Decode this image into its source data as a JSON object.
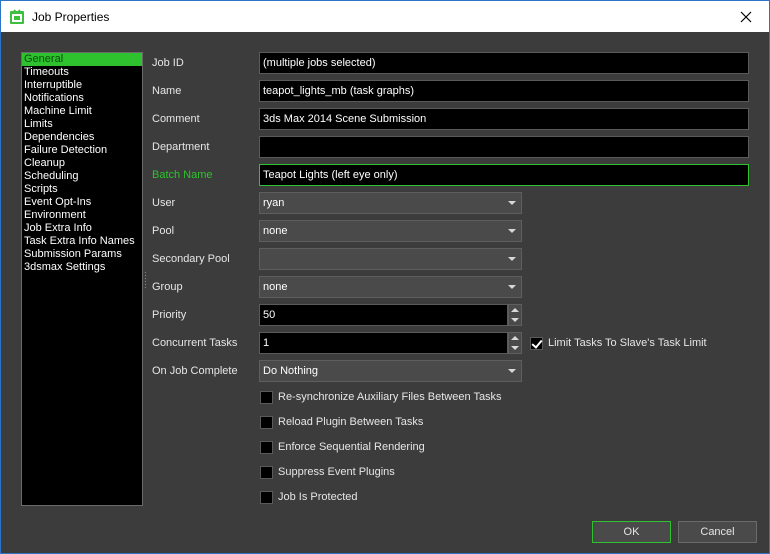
{
  "window": {
    "title": "Job Properties"
  },
  "nav": {
    "items": [
      {
        "label": "General",
        "selected": true
      },
      {
        "label": "Timeouts",
        "selected": false
      },
      {
        "label": "Interruptible",
        "selected": false
      },
      {
        "label": "Notifications",
        "selected": false
      },
      {
        "label": "Machine Limit",
        "selected": false
      },
      {
        "label": "Limits",
        "selected": false
      },
      {
        "label": "Dependencies",
        "selected": false
      },
      {
        "label": "Failure Detection",
        "selected": false
      },
      {
        "label": "Cleanup",
        "selected": false
      },
      {
        "label": "Scheduling",
        "selected": false
      },
      {
        "label": "Scripts",
        "selected": false
      },
      {
        "label": "Event Opt-Ins",
        "selected": false
      },
      {
        "label": "Environment",
        "selected": false
      },
      {
        "label": "Job Extra Info",
        "selected": false
      },
      {
        "label": "Task Extra Info Names",
        "selected": false
      },
      {
        "label": "Submission Params",
        "selected": false
      },
      {
        "label": "3dsmax Settings",
        "selected": false
      }
    ]
  },
  "form": {
    "job_id": {
      "label": "Job ID",
      "value": "(multiple jobs selected)"
    },
    "name": {
      "label": "Name",
      "value": "teapot_lights_mb   (task graphs)"
    },
    "comment": {
      "label": "Comment",
      "value": "3ds Max 2014 Scene Submission"
    },
    "department": {
      "label": "Department",
      "value": ""
    },
    "batch_name": {
      "label": "Batch Name",
      "value": "Teapot Lights (left eye only)"
    },
    "user": {
      "label": "User",
      "value": "ryan"
    },
    "pool": {
      "label": "Pool",
      "value": "none"
    },
    "secondary_pool": {
      "label": "Secondary Pool",
      "value": ""
    },
    "group": {
      "label": "Group",
      "value": "none"
    },
    "priority": {
      "label": "Priority",
      "value": "50"
    },
    "concurrent_tasks": {
      "label": "Concurrent Tasks",
      "value": "1"
    },
    "limit_tasks": {
      "label": "Limit Tasks To Slave's Task Limit",
      "checked": true
    },
    "on_job_complete": {
      "label": "On Job Complete",
      "value": "Do Nothing"
    },
    "options": [
      {
        "label": "Re-synchronize Auxiliary Files Between Tasks",
        "checked": false
      },
      {
        "label": "Reload Plugin Between Tasks",
        "checked": false
      },
      {
        "label": "Enforce Sequential Rendering",
        "checked": false
      },
      {
        "label": "Suppress Event Plugins",
        "checked": false
      },
      {
        "label": "Job Is Protected",
        "checked": false
      }
    ]
  },
  "buttons": {
    "ok": "OK",
    "cancel": "Cancel"
  },
  "colors": {
    "accent": "#2ec32e",
    "background": "#3c3c3c",
    "field_bg": "#000000",
    "title_border": "#2b74c7"
  },
  "icons": {
    "app": "deadline-monitor-icon",
    "close": "close-icon",
    "dropdown": "chevron-down-icon",
    "spin_up": "spin-up-icon",
    "spin_down": "spin-down-icon"
  }
}
